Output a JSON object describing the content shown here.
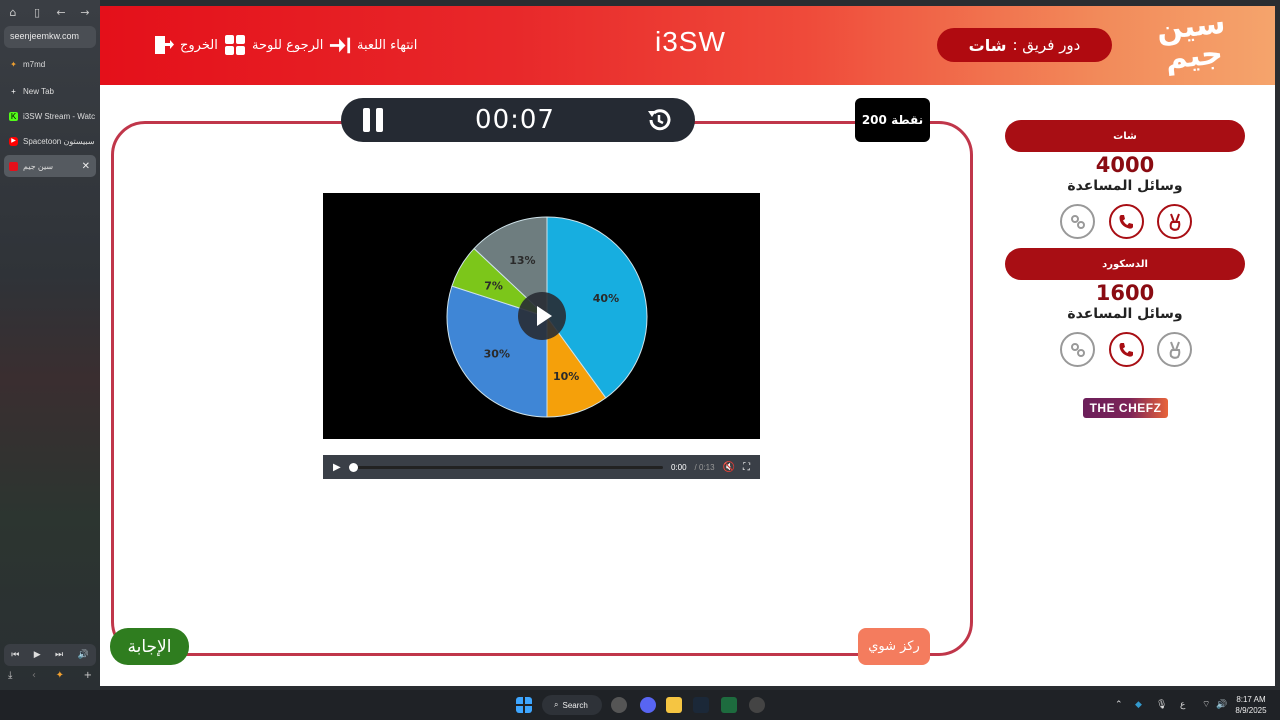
{
  "browser": {
    "url": "seenjeemkw.com",
    "tabs": [
      {
        "label": "m7md",
        "icon": "sparkle-icon",
        "color": "#f0a030"
      },
      {
        "label": "New Tab",
        "icon": "plus-icon",
        "color": "#cccccc"
      },
      {
        "label": "i3SW Stream - Watc",
        "icon": "kick-icon",
        "color": "#53fc18"
      },
      {
        "label": "Spacetoon سبيستون 🎵",
        "icon": "youtube-icon",
        "color": "#ff0000"
      },
      {
        "label": "سين جيم",
        "icon": "seenjeem-icon",
        "color": "#e4101a"
      }
    ]
  },
  "header": {
    "exit_label": "الخروج",
    "board_label": "الرجوع للوحة",
    "end_label": "انتهاء اللعبة",
    "brand": "i3SW",
    "turn_prefix": "دور فريق :",
    "turn_team": "شات",
    "logo_text": "سين جيم"
  },
  "question": {
    "timer": "00:07",
    "points": "200 نقطة",
    "video": {
      "current_time": "0:00",
      "total_time": "/ 0:13"
    },
    "answer_label": "الإجابة",
    "focus_label": "ركز شوي"
  },
  "chart_data": {
    "type": "pie",
    "labels": [
      "40%",
      "10%",
      "30%",
      "7%",
      "13%"
    ],
    "values": [
      40,
      10,
      30,
      7,
      13
    ],
    "colors": [
      "#17aee0",
      "#f5a00a",
      "#3f86d6",
      "#7cc61a",
      "#6e7d7f"
    ]
  },
  "teams": [
    {
      "name": "شات",
      "score": "4000",
      "helpers_label": "وسائل المساعدة"
    },
    {
      "name": "الدسكورد",
      "score": "1600",
      "helpers_label": "وسائل المساعدة"
    }
  ],
  "sponsor": "THE CHEFZ",
  "taskbar": {
    "search_label": "Search",
    "lang": "ع",
    "time": "8:17 AM",
    "date": "8/9/2025"
  }
}
